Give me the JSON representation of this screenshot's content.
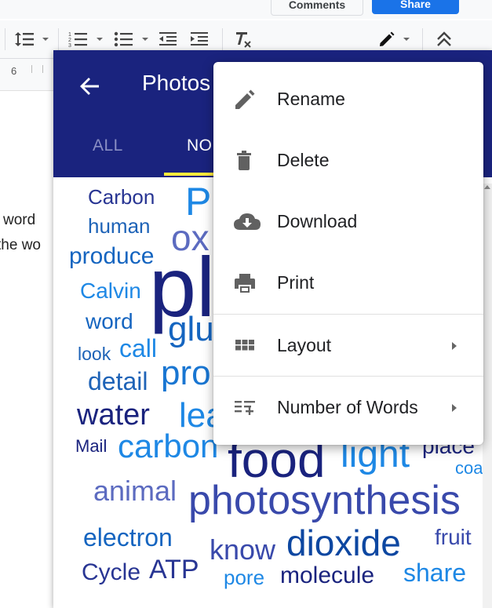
{
  "docs": {
    "comments_label": "Comments",
    "share_label": "Share",
    "ruler_number": "6",
    "doc_lines": [
      "word",
      "the wo"
    ]
  },
  "panel": {
    "title": "Photos",
    "tabs": [
      {
        "label": "ALL",
        "active": false
      },
      {
        "label": "NO",
        "active": true
      }
    ]
  },
  "menu": {
    "items": [
      {
        "label": "Rename",
        "icon": "pencil-icon"
      },
      {
        "label": "Delete",
        "icon": "trash-icon"
      },
      {
        "label": "Download",
        "icon": "cloud-download-icon"
      },
      {
        "label": "Print",
        "icon": "printer-icon"
      },
      {
        "label": "Layout",
        "icon": "grid-icon",
        "submenu": true
      },
      {
        "label": "Number of Words",
        "icon": "add-list-icon",
        "submenu": true
      }
    ]
  },
  "colors": {
    "header": "#1a237e",
    "tab_indicator": "#ffeb3b",
    "share_button": "#1a73e8"
  },
  "cloud_words": [
    "Carbon",
    "human",
    "Ph",
    "ox",
    "produce",
    "pl",
    "Calvin",
    "word",
    "glu",
    "look",
    "call",
    "detail",
    "pro",
    "water",
    "lea",
    "Mail",
    "carbon",
    "food",
    "light",
    "place",
    "coa",
    "animal",
    "photosynthesis",
    "electron",
    "know",
    "dioxide",
    "fruit",
    "Cycle",
    "ATP",
    "pore",
    "molecule",
    "share"
  ]
}
